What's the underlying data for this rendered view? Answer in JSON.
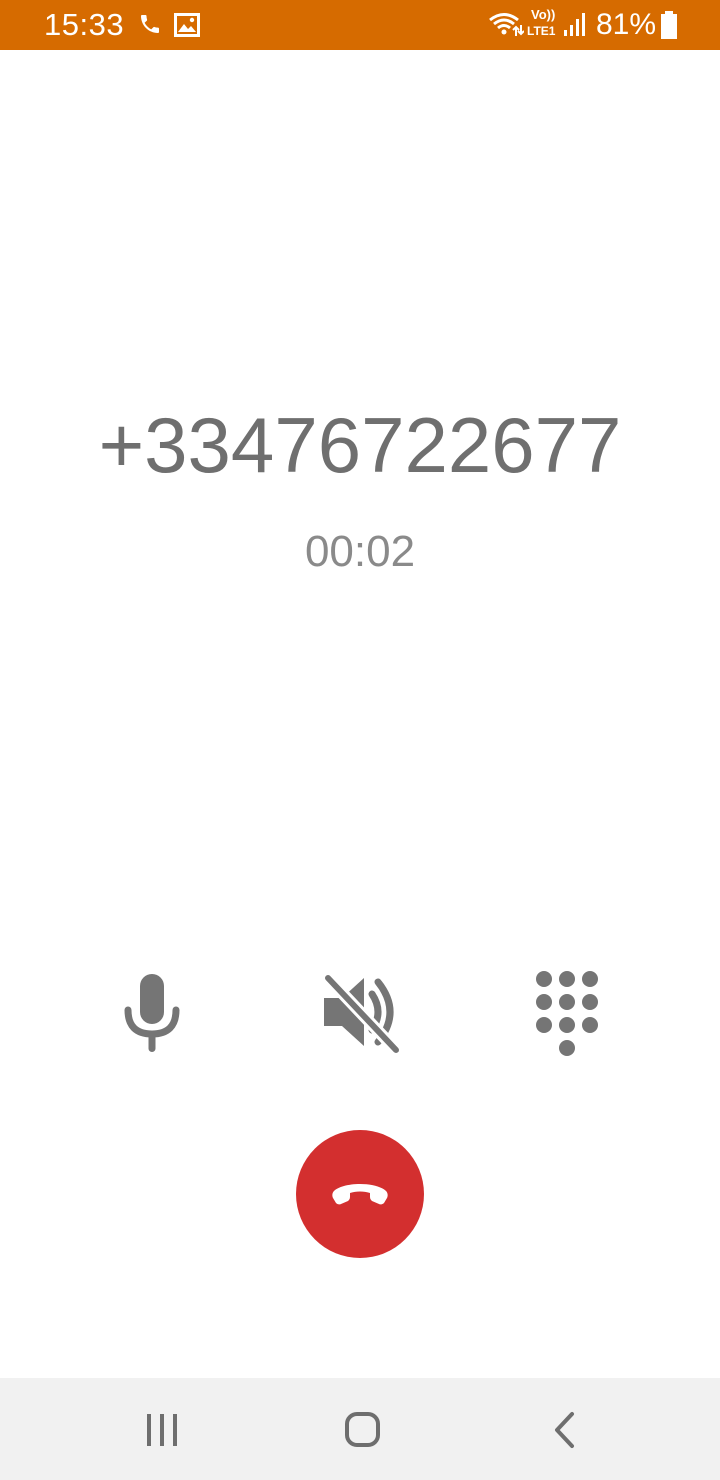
{
  "status_bar": {
    "time": "15:33",
    "volte_top": "Vo))",
    "volte_bottom": "LTE1",
    "battery_percent": "81%",
    "background_color": "#d66b00",
    "icons": [
      "phone-call-icon",
      "image-icon",
      "wifi-icon",
      "signal-icon",
      "battery-icon"
    ]
  },
  "call": {
    "number": "+33476722677",
    "timer": "00:02"
  },
  "controls": {
    "mute_icon": "microphone-icon",
    "speaker_icon": "speaker-muted-icon",
    "keypad_icon": "dialpad-icon",
    "icon_color": "#757575"
  },
  "end_call": {
    "icon": "call-end-icon",
    "color": "#d32f2f"
  },
  "nav_bar": {
    "icons": [
      "recent-apps-icon",
      "home-icon",
      "back-icon"
    ]
  }
}
